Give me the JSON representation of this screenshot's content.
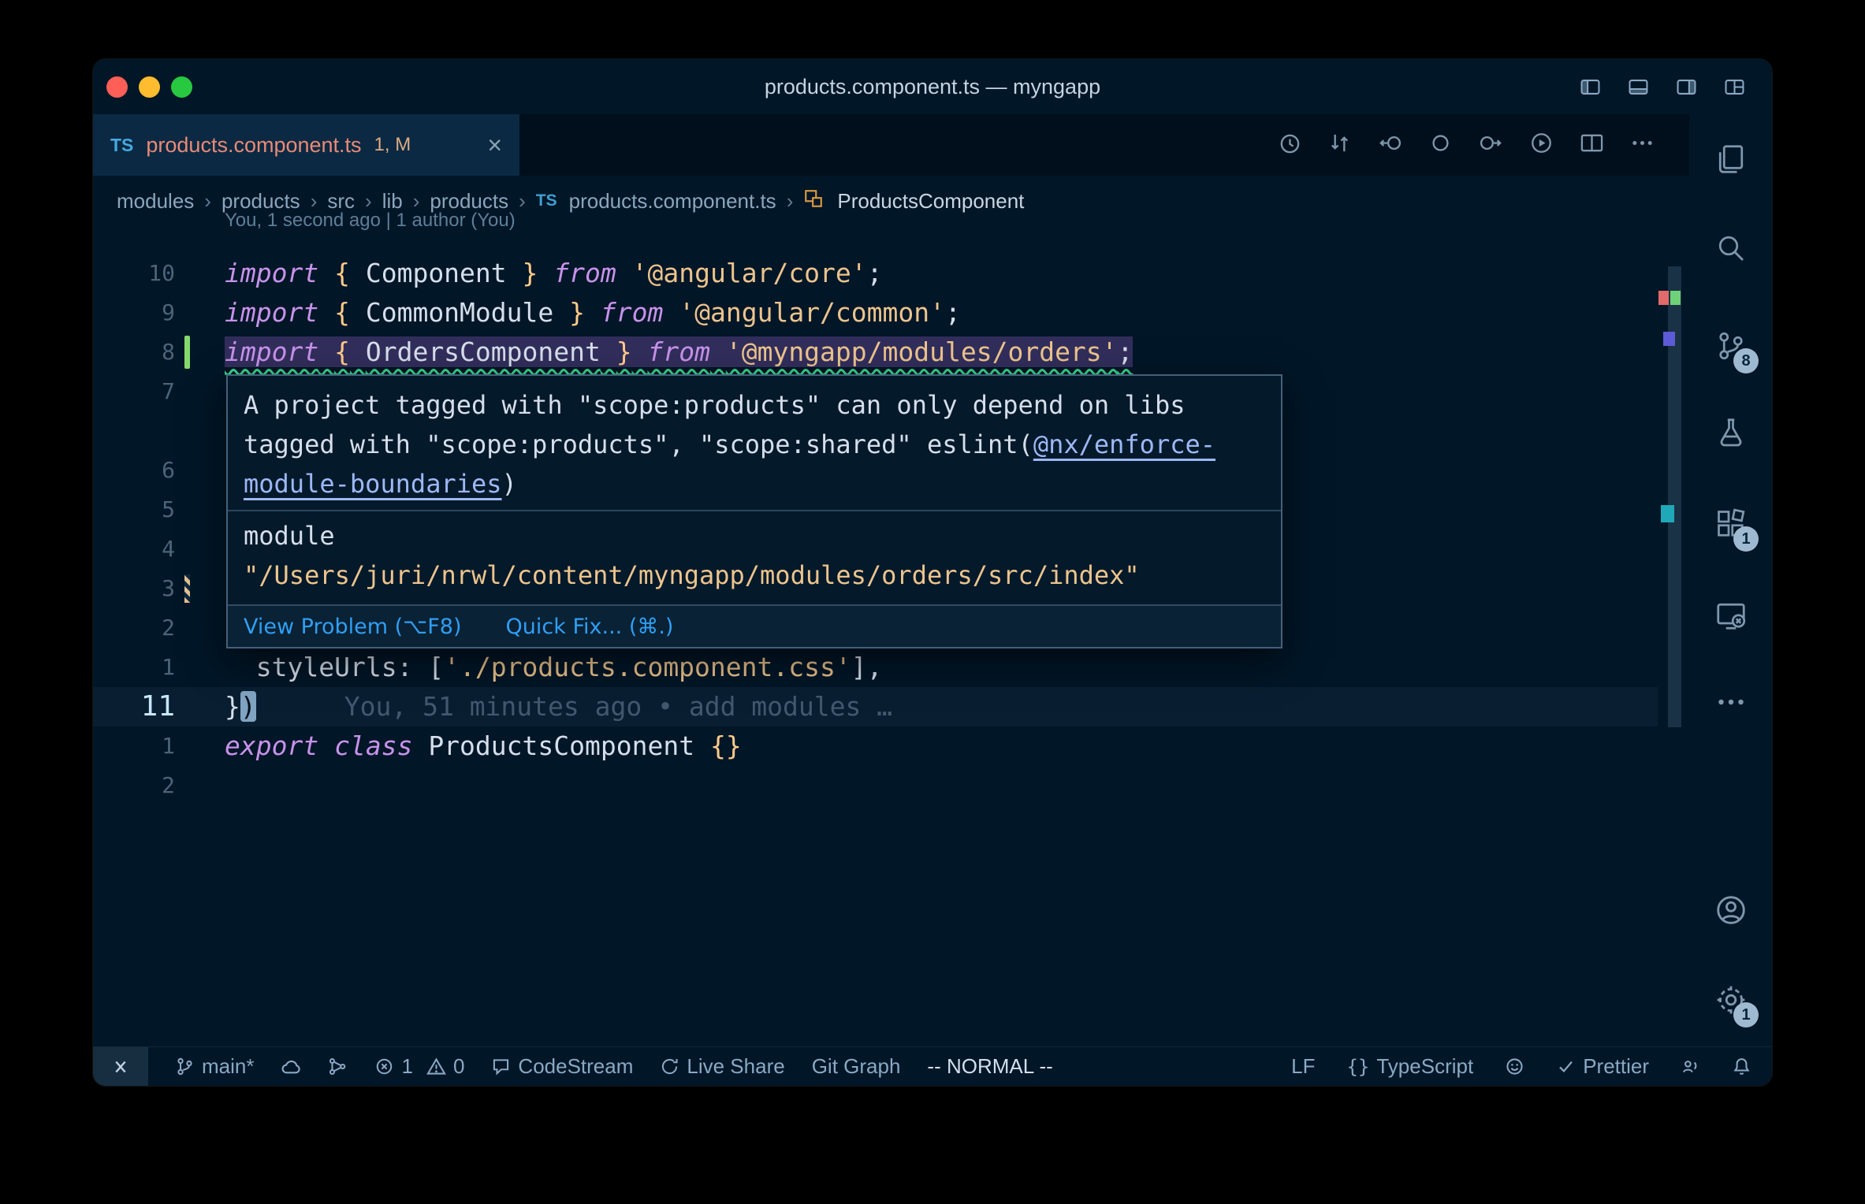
{
  "window": {
    "title": "products.component.ts — myngapp"
  },
  "tab": {
    "file_type": "TS",
    "label": "products.component.ts",
    "decoration": "1, M",
    "close_glyph": "×"
  },
  "breadcrumb": {
    "separator": "›",
    "items": [
      "modules",
      "products",
      "src",
      "lib",
      "products",
      "products.component.ts",
      "ProductsComponent"
    ]
  },
  "editor": {
    "lens_annotation": "You, 1 second ago | 1 author (You)",
    "rows": [
      {
        "n": "10",
        "tokens": [
          {
            "t": "import",
            "c": "kw"
          },
          {
            "t": " ",
            "c": "pl"
          },
          {
            "t": "{",
            "c": "brace"
          },
          {
            "t": " ",
            "c": "pl"
          },
          {
            "t": "Component",
            "c": "id"
          },
          {
            "t": " ",
            "c": "pl"
          },
          {
            "t": "}",
            "c": "brace"
          },
          {
            "t": " ",
            "c": "pl"
          },
          {
            "t": "from",
            "c": "kw"
          },
          {
            "t": " ",
            "c": "pl"
          },
          {
            "t": "'@angular/core'",
            "c": "str"
          },
          {
            "t": ";",
            "c": "pl"
          }
        ]
      },
      {
        "n": "9",
        "tokens": [
          {
            "t": "import",
            "c": "kw"
          },
          {
            "t": " ",
            "c": "pl"
          },
          {
            "t": "{",
            "c": "brace"
          },
          {
            "t": " ",
            "c": "pl"
          },
          {
            "t": "CommonModule",
            "c": "id"
          },
          {
            "t": " ",
            "c": "pl"
          },
          {
            "t": "}",
            "c": "brace"
          },
          {
            "t": " ",
            "c": "pl"
          },
          {
            "t": "from",
            "c": "kw"
          },
          {
            "t": " ",
            "c": "pl"
          },
          {
            "t": "'@angular/common'",
            "c": "str"
          },
          {
            "t": ";",
            "c": "pl"
          }
        ]
      },
      {
        "n": "8",
        "squiggle": true,
        "gutter": "added",
        "tokens": [
          {
            "t": "import",
            "c": "kw"
          },
          {
            "t": " ",
            "c": "pl"
          },
          {
            "t": "{",
            "c": "brace"
          },
          {
            "t": " ",
            "c": "pl"
          },
          {
            "t": "OrdersComponent",
            "c": "id"
          },
          {
            "t": " ",
            "c": "pl"
          },
          {
            "t": "}",
            "c": "brace"
          },
          {
            "t": " ",
            "c": "pl"
          },
          {
            "t": "from",
            "c": "kw"
          },
          {
            "t": " ",
            "c": "pl"
          },
          {
            "t": "'@myngapp/modules/orders'",
            "c": "str"
          },
          {
            "t": ";",
            "c": "pl"
          }
        ]
      },
      {
        "n": "7",
        "tokens": []
      },
      {
        "n": "6",
        "tokens": []
      },
      {
        "n": "5",
        "tokens": []
      },
      {
        "n": "4",
        "tokens": []
      },
      {
        "n": "3",
        "gutter": "modified",
        "tokens": []
      },
      {
        "n": "2",
        "tokens": []
      },
      {
        "n": "1",
        "tokens": [
          {
            "t": "  ",
            "c": "pl"
          },
          {
            "t": "styleUrls",
            "c": "prop"
          },
          {
            "t": ": [",
            "c": "pl"
          },
          {
            "t": "'./products.component.css'",
            "c": "str"
          },
          {
            "t": "],",
            "c": "pl"
          }
        ]
      },
      {
        "n": "11",
        "current": true,
        "tokens": [
          {
            "t": "}",
            "c": "pl"
          },
          {
            "t": ")",
            "c": "cursor"
          },
          {
            "t": "You, 51 minutes ago • add modules …",
            "c": "ghost"
          }
        ]
      },
      {
        "n": "1",
        "tokens": [
          {
            "t": "export",
            "c": "kw"
          },
          {
            "t": " ",
            "c": "pl"
          },
          {
            "t": "class",
            "c": "kw"
          },
          {
            "t": " ",
            "c": "pl"
          },
          {
            "t": "ProductsComponent",
            "c": "id"
          },
          {
            "t": " ",
            "c": "pl"
          },
          {
            "t": "{}",
            "c": "brace"
          }
        ]
      },
      {
        "n": "2",
        "tokens": []
      }
    ]
  },
  "popup": {
    "message_line1": "A project tagged with \"scope:products\" can only depend on libs",
    "message_line2": "tagged with \"scope:products\", \"scope:shared\" eslint(",
    "message_link_line2": "@nx/enforce-",
    "message_link_line3": "module-boundaries",
    "message_line3_end": ")",
    "module_label": "module",
    "module_path": "\"/Users/juri/nrwl/content/myngapp/modules/orders/src/index\"",
    "view_problem": "View Problem (⌥F8)",
    "quick_fix": "Quick Fix... (⌘.)"
  },
  "status_bar": {
    "branch": "main*",
    "errors": "1",
    "warnings": "0",
    "codestream": "CodeStream",
    "live_share": "Live Share",
    "git_graph": "Git Graph",
    "mode": "-- NORMAL --",
    "eol": "LF",
    "language_icon": "{}",
    "language": "TypeScript",
    "prettier": "Prettier"
  },
  "activity_bar": {
    "scm_badge": "8",
    "extensions_badge": "1",
    "settings_badge": "1"
  }
}
